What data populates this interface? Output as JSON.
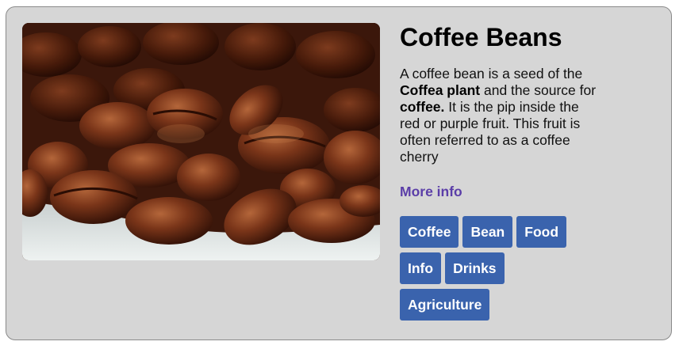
{
  "card": {
    "title": "Coffee Beans",
    "description": {
      "part1": "A coffee bean is a seed of the ",
      "bold1": "Coffea plant",
      "part2": " and the source for ",
      "bold2": "coffee.",
      "part3": " It is the pip inside the red or purple fruit. This fruit is often referred to as a coffee cherry"
    },
    "more_link": "More info",
    "tags": [
      "Coffee",
      "Bean",
      "Food",
      "Info",
      "Drinks",
      "Agriculture"
    ],
    "image": {
      "subject": "coffee-beans-photo"
    }
  },
  "colors": {
    "card_background": "#d6d6d6",
    "tag_background": "#3a63ad",
    "link": "#5b3ea8"
  }
}
